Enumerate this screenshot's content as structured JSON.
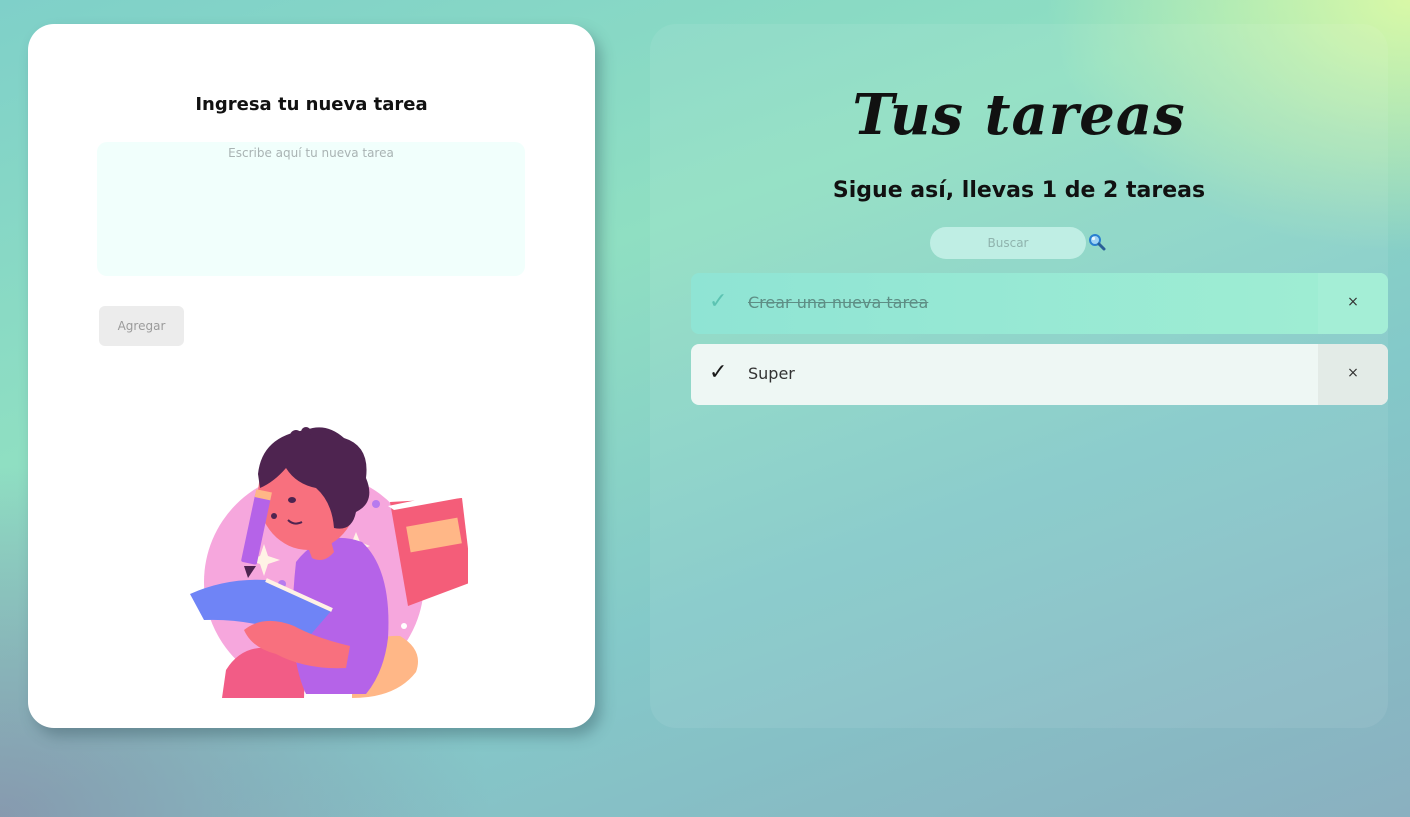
{
  "form": {
    "title": "Ingresa tu nueva tarea",
    "textarea_placeholder": "Escribe aquí tu nueva tarea",
    "add_button_label": "Agregar"
  },
  "tasks_panel": {
    "title": "Tus tareas",
    "progress": {
      "text": "Sigue así, llevas 1 de 2 tareas",
      "completed": 1,
      "total": 2
    },
    "search_placeholder": "Buscar",
    "search_icon": "magnifier-icon",
    "items": [
      {
        "text": "Crear una nueva tarea",
        "completed": true,
        "check_glyph": "✓",
        "delete_glyph": "×"
      },
      {
        "text": "Super",
        "completed": false,
        "check_glyph": "✓",
        "delete_glyph": "×"
      }
    ]
  },
  "illustration": "girl-reading-book-illustration",
  "colors": {
    "card_bg": "#ffffff",
    "textarea_bg": "#f1fffc",
    "search_bg": "#bfeee4",
    "completed_item_bg": "#97e9d4",
    "pending_item_bg": "#eef7f4",
    "check_completed": "#5cc3b2"
  }
}
